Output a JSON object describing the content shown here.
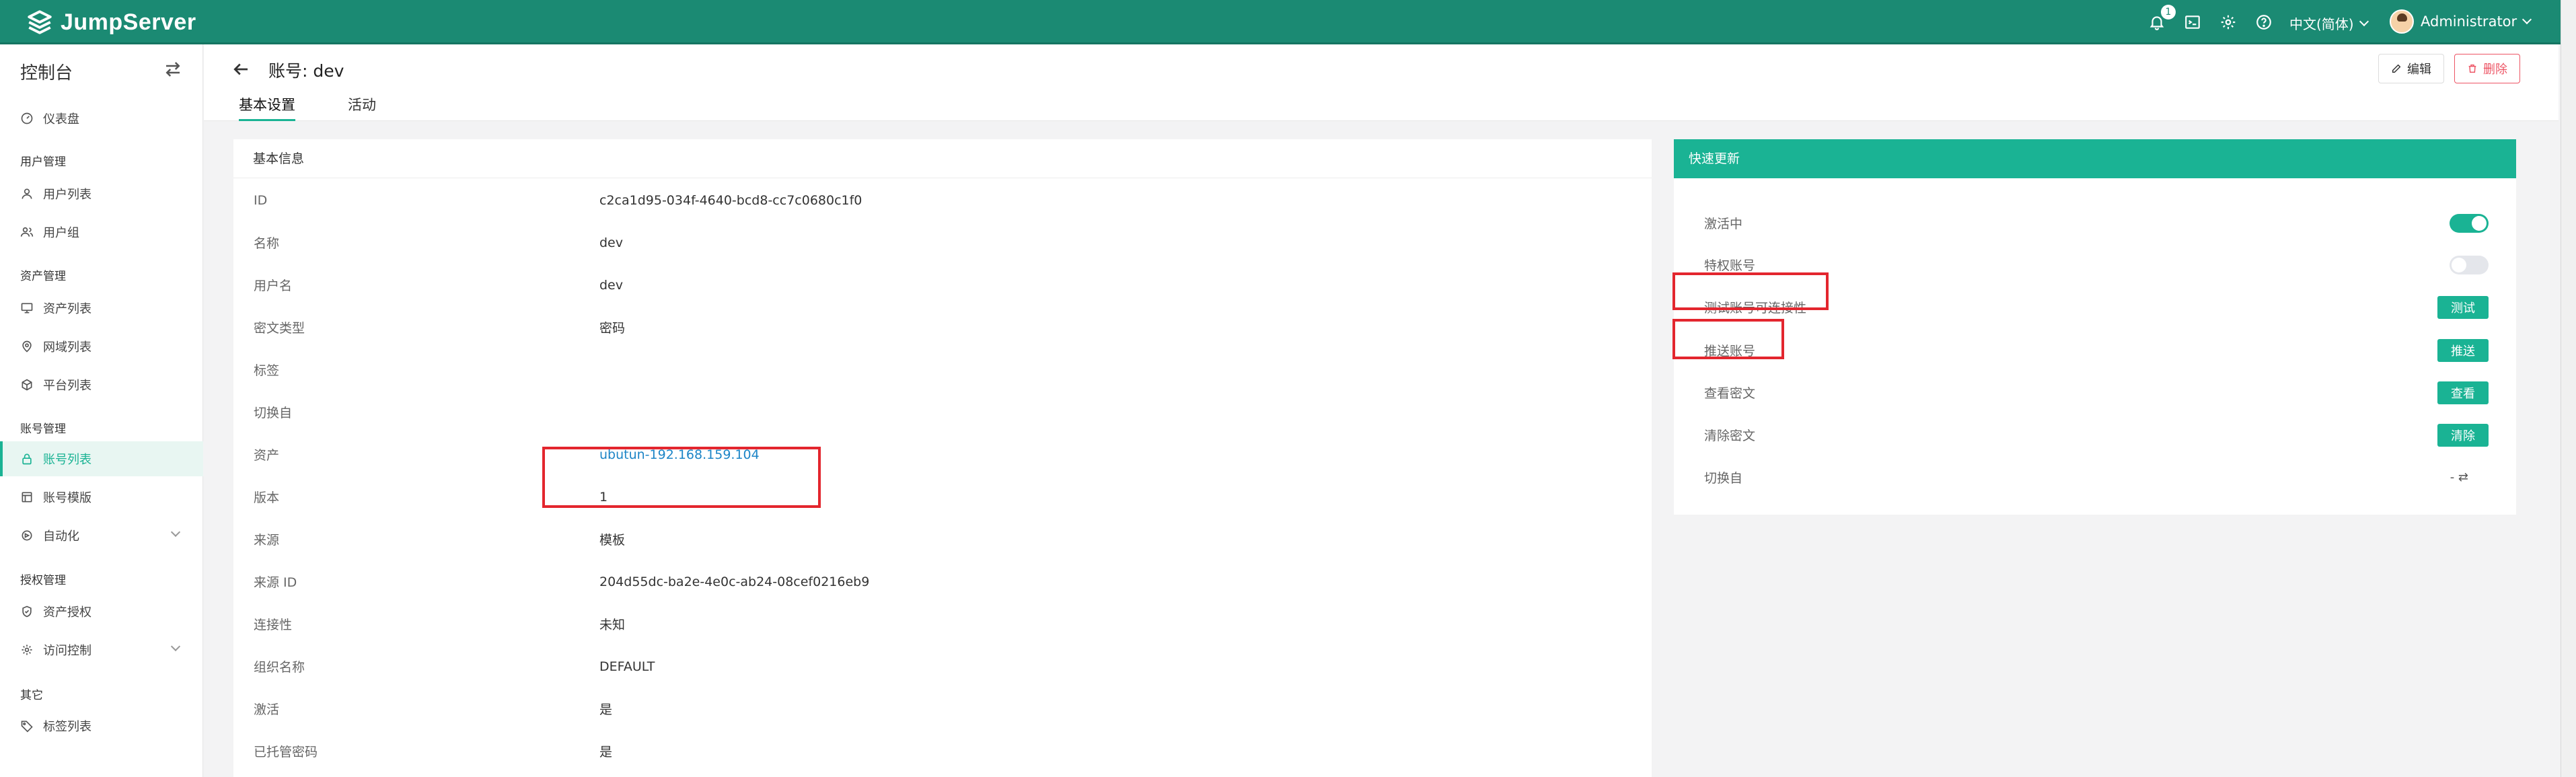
{
  "brand": {
    "name": "JumpServer",
    "primary": "#1ab394",
    "header_bg": "#1b8a73",
    "highlight": "#e3262e"
  },
  "topbar": {
    "notification_count": "1",
    "language": "中文(简体)",
    "user": "Administrator",
    "icons": [
      "bell-icon",
      "terminal-icon",
      "gear-icon",
      "help-icon"
    ]
  },
  "sidebar": {
    "title": "控制台",
    "dashboard": "仪表盘",
    "groups": {
      "users": "用户管理",
      "assets": "资产管理",
      "accounts": "账号管理",
      "perms": "授权管理",
      "other": "其它"
    },
    "items": {
      "user_list": "用户列表",
      "user_group": "用户组",
      "asset_list": "资产列表",
      "domain_list": "网域列表",
      "platform_list": "平台列表",
      "account_list": "账号列表",
      "account_template": "账号模版",
      "automation": "自动化",
      "asset_perm": "资产授权",
      "access_control": "访问控制",
      "label_list": "标签列表"
    }
  },
  "header": {
    "title": "账号: dev",
    "tabs": [
      "基本设置",
      "活动"
    ],
    "edit": "编辑",
    "delete": "删除"
  },
  "basic": {
    "title": "基本信息",
    "rows": [
      {
        "k": "ID",
        "v": "c2ca1d95-034f-4640-bcd8-cc7c0680c1f0"
      },
      {
        "k": "名称",
        "v": "dev"
      },
      {
        "k": "用户名",
        "v": "dev"
      },
      {
        "k": "密文类型",
        "v": "密码"
      },
      {
        "k": "标签",
        "v": ""
      },
      {
        "k": "切换自",
        "v": ""
      },
      {
        "k": "资产",
        "v": "ubutun-192.168.159.104"
      },
      {
        "k": "版本",
        "v": "1"
      },
      {
        "k": "来源",
        "v": "模板"
      },
      {
        "k": "来源 ID",
        "v": "204d55dc-ba2e-4e0c-ab24-08cef0216eb9"
      },
      {
        "k": "连接性",
        "v": "未知"
      },
      {
        "k": "组织名称",
        "v": "DEFAULT"
      },
      {
        "k": "激活",
        "v": "是"
      },
      {
        "k": "已托管密码",
        "v": "是"
      }
    ]
  },
  "quick": {
    "title": "快速更新",
    "active": {
      "label": "激活中",
      "on": true
    },
    "privileged": {
      "label": "特权账号",
      "on": false
    },
    "test": {
      "label": "测试账号可连接性",
      "btn": "测试"
    },
    "push": {
      "label": "推送账号",
      "btn": "推送"
    },
    "view": {
      "label": "查看密文",
      "btn": "查看"
    },
    "clear": {
      "label": "清除密文",
      "btn": "清除"
    },
    "switch": {
      "label": "切换自",
      "value": "- ⇄"
    }
  }
}
